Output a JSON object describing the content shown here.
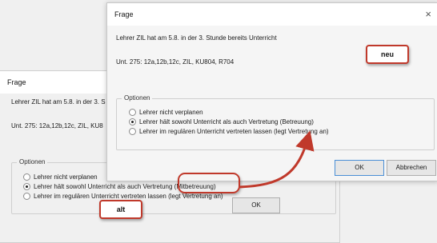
{
  "old_dialog": {
    "title": "Frage",
    "message": "Lehrer ZIL hat am 5.8. in der 3. S",
    "detail": "Unt. 275: 12a,12b,12c, ZIL, KU8",
    "options_legend": "Optionen",
    "options": [
      {
        "label": "Lehrer nicht verplanen",
        "selected": false
      },
      {
        "label": "Lehrer hält sowohl Unterricht als auch Vertretung (Mitbetreuung)",
        "selected": true
      },
      {
        "label": "Lehrer im regulären Unterricht vertreten lassen (legt Vertretung an)",
        "selected": false
      }
    ],
    "ok_label": "OK"
  },
  "new_dialog": {
    "title": "Frage",
    "close_glyph": "×",
    "message": "Lehrer ZIL hat am 5.8. in der 3. Stunde bereits Unterricht",
    "detail": "Unt. 275: 12a,12b,12c, ZIL, KU804, R704",
    "options_legend": "Optionen",
    "options": [
      {
        "label": "Lehrer nicht verplanen",
        "selected": false
      },
      {
        "label": "Lehrer hält sowohl Unterricht als auch Vertretung (Betreuung)",
        "selected": true
      },
      {
        "label": "Lehrer im regulären Unterricht vertreten lassen (legt Vertretung an)",
        "selected": false
      }
    ],
    "ok_label": "OK",
    "cancel_label": "Abbrechen"
  },
  "annotations": {
    "old_tag": "alt",
    "new_tag": "neu",
    "accent_color": "#c0392b"
  }
}
